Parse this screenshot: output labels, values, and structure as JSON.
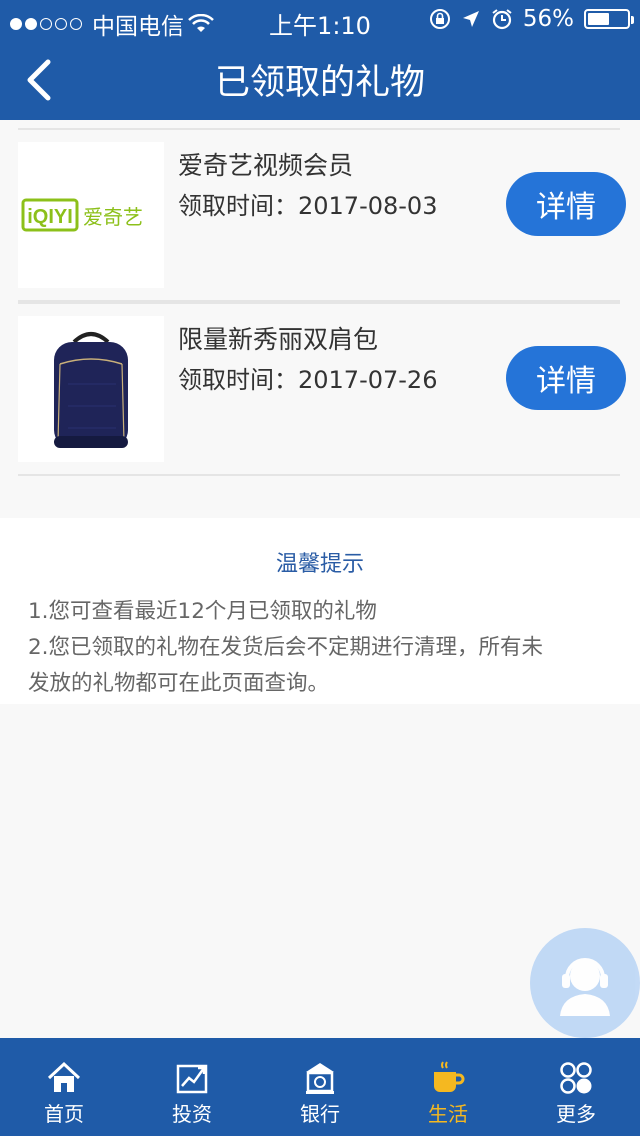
{
  "status_bar": {
    "carrier": "中国电信",
    "time": "上午1:10",
    "battery_percent": "56%",
    "battery_level": 0.56
  },
  "navbar": {
    "title": "已领取的礼物"
  },
  "gifts": [
    {
      "name": "爱奇艺视频会员",
      "date": "领取时间：2017-08-03",
      "button": "详情",
      "logo_text": "iQIYI",
      "logo_subtext": "爱奇艺",
      "logo_color": "#8cc01a"
    },
    {
      "name": "限量新秀丽双肩包",
      "date": "领取时间：2017-07-26",
      "button": "详情"
    }
  ],
  "tips": {
    "title": "温馨提示",
    "line1": "1.您可查看最近12个月已领取的礼物",
    "line2": "2.您已领取的礼物在发货后会不定期进行清理，所有未",
    "line3": "发放的礼物都可在此页面查询。"
  },
  "tabs": [
    {
      "label": "首页",
      "icon": "home-icon"
    },
    {
      "label": "投资",
      "icon": "chart-icon"
    },
    {
      "label": "银行",
      "icon": "bank-icon"
    },
    {
      "label": "生活",
      "icon": "cup-icon",
      "active": true
    },
    {
      "label": "更多",
      "icon": "more-icon"
    }
  ],
  "colors": {
    "primary": "#1f5ba8",
    "button": "#2574d8",
    "active_tab": "#f5b820",
    "tips_title": "#2a5ca5"
  }
}
